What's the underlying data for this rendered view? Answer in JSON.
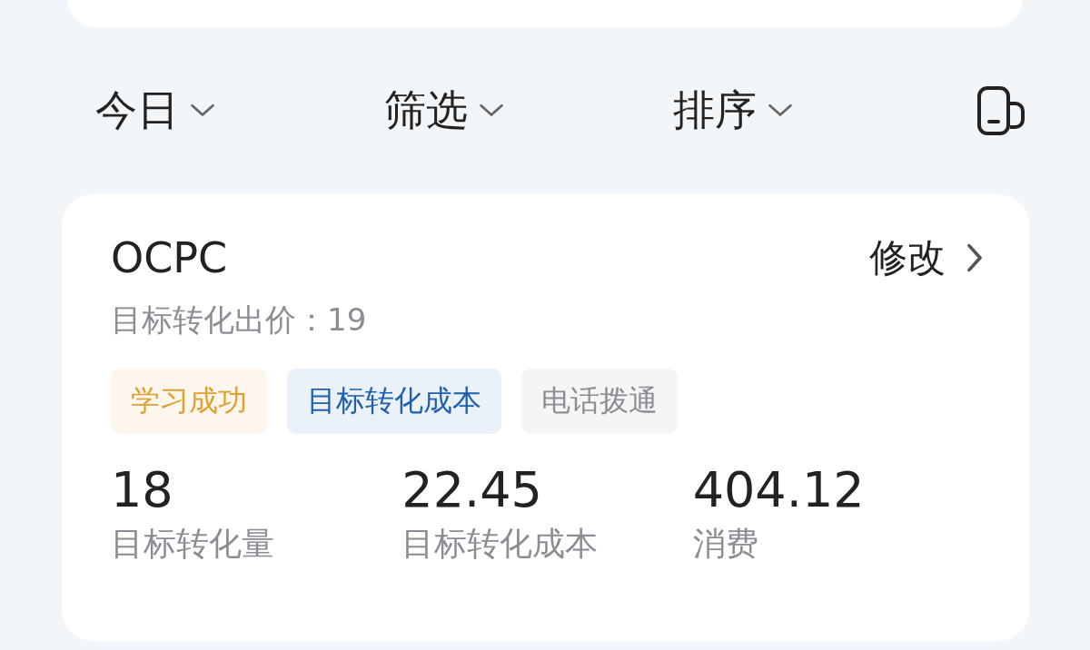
{
  "filters": [
    {
      "label": "今日"
    },
    {
      "label": "筛选"
    },
    {
      "label": "排序"
    }
  ],
  "card": {
    "title": "OCPC",
    "action": "修改",
    "bid_label": "目标转化出价：",
    "bid_value": "19",
    "tags": [
      {
        "label": "学习成功",
        "color": "#e0a030"
      },
      {
        "label": "目标转化成本",
        "color": "#1f5fae"
      },
      {
        "label": "电话拨通",
        "color": "#8a8d93"
      }
    ],
    "metrics": [
      {
        "value": "18",
        "label": "目标转化量"
      },
      {
        "value": "22.45",
        "label": "目标转化成本"
      },
      {
        "value": "404.12",
        "label": "消费"
      }
    ]
  }
}
